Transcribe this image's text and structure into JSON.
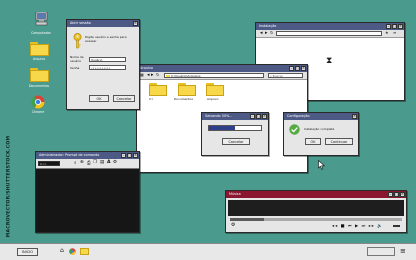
{
  "desktop": {
    "icons": [
      {
        "label": "Computador"
      },
      {
        "label": "Arquivo"
      },
      {
        "label": "Documentos"
      },
      {
        "label": "Chrome"
      }
    ],
    "watermark": "MACROVECTOR/SHUTTERSTOCK.COM"
  },
  "login": {
    "title": "Abrir sessão",
    "prompt": "Digite usuário e senha para acessar",
    "user_label": "Nome de usuário",
    "user_value": "Usuário",
    "pass_label": "Senha",
    "pass_value": "•••••••••••",
    "ok": "OK",
    "cancel": "Cancelar"
  },
  "browser": {
    "title": "Instalação",
    "hourglass": "⧗"
  },
  "explorer": {
    "title": "Arquivo",
    "path": "C:\\Usuário\\Arquivos",
    "search_placeholder": "Buscar",
    "folders": [
      {
        "label": "C:\\"
      },
      {
        "label": "Documentos"
      },
      {
        "label": "Arquivo"
      }
    ]
  },
  "progress": {
    "title": "Salvando 50%...",
    "value": 0.5,
    "cancel": "Cancelar"
  },
  "config": {
    "title": "Configuração",
    "message": "Instalação completa",
    "ok": "OK",
    "continue": "Continuar"
  },
  "terminal": {
    "title": "Administrador: Prompt de comando",
    "prompt": "C:\\>"
  },
  "media": {
    "title": "Música",
    "progress": 0.2
  },
  "taskbar": {
    "start": "INICIO",
    "menu_icon": "hamburger-icon"
  },
  "colors": {
    "desktop": "#4a9a8d",
    "titlebar": "#4e5a86",
    "media_titlebar": "#8a1630",
    "folder": "#f7d84a",
    "check": "#58a844"
  }
}
